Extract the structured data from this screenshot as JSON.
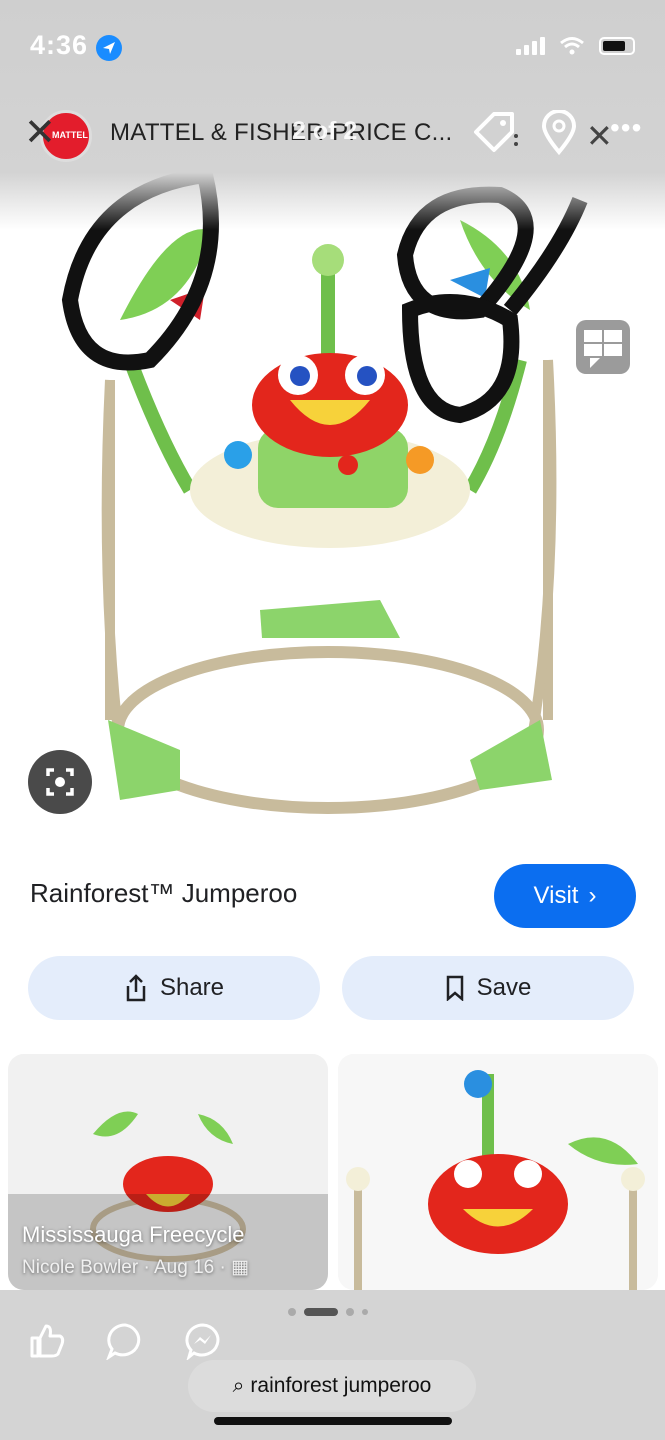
{
  "status": {
    "time": "4:36"
  },
  "header": {
    "brand_title": "MATTEL & FISHER-PRICE C...",
    "counter": "2 of 2",
    "logo_text": "MATTEL"
  },
  "product": {
    "title": "Rainforest™ Jumperoo",
    "visit_label": "Visit"
  },
  "actions": {
    "share_label": "Share",
    "save_label": "Save"
  },
  "related": [
    {
      "caption": "Mississauga Freecycle",
      "author": "Nicole Bowler",
      "date": "Aug 16"
    },
    {
      "caption": ""
    }
  ],
  "bottom": {
    "query": "rainforest jumperoo"
  },
  "colors": {
    "accent": "#0b6ef0",
    "pill": "#e4edfb"
  }
}
